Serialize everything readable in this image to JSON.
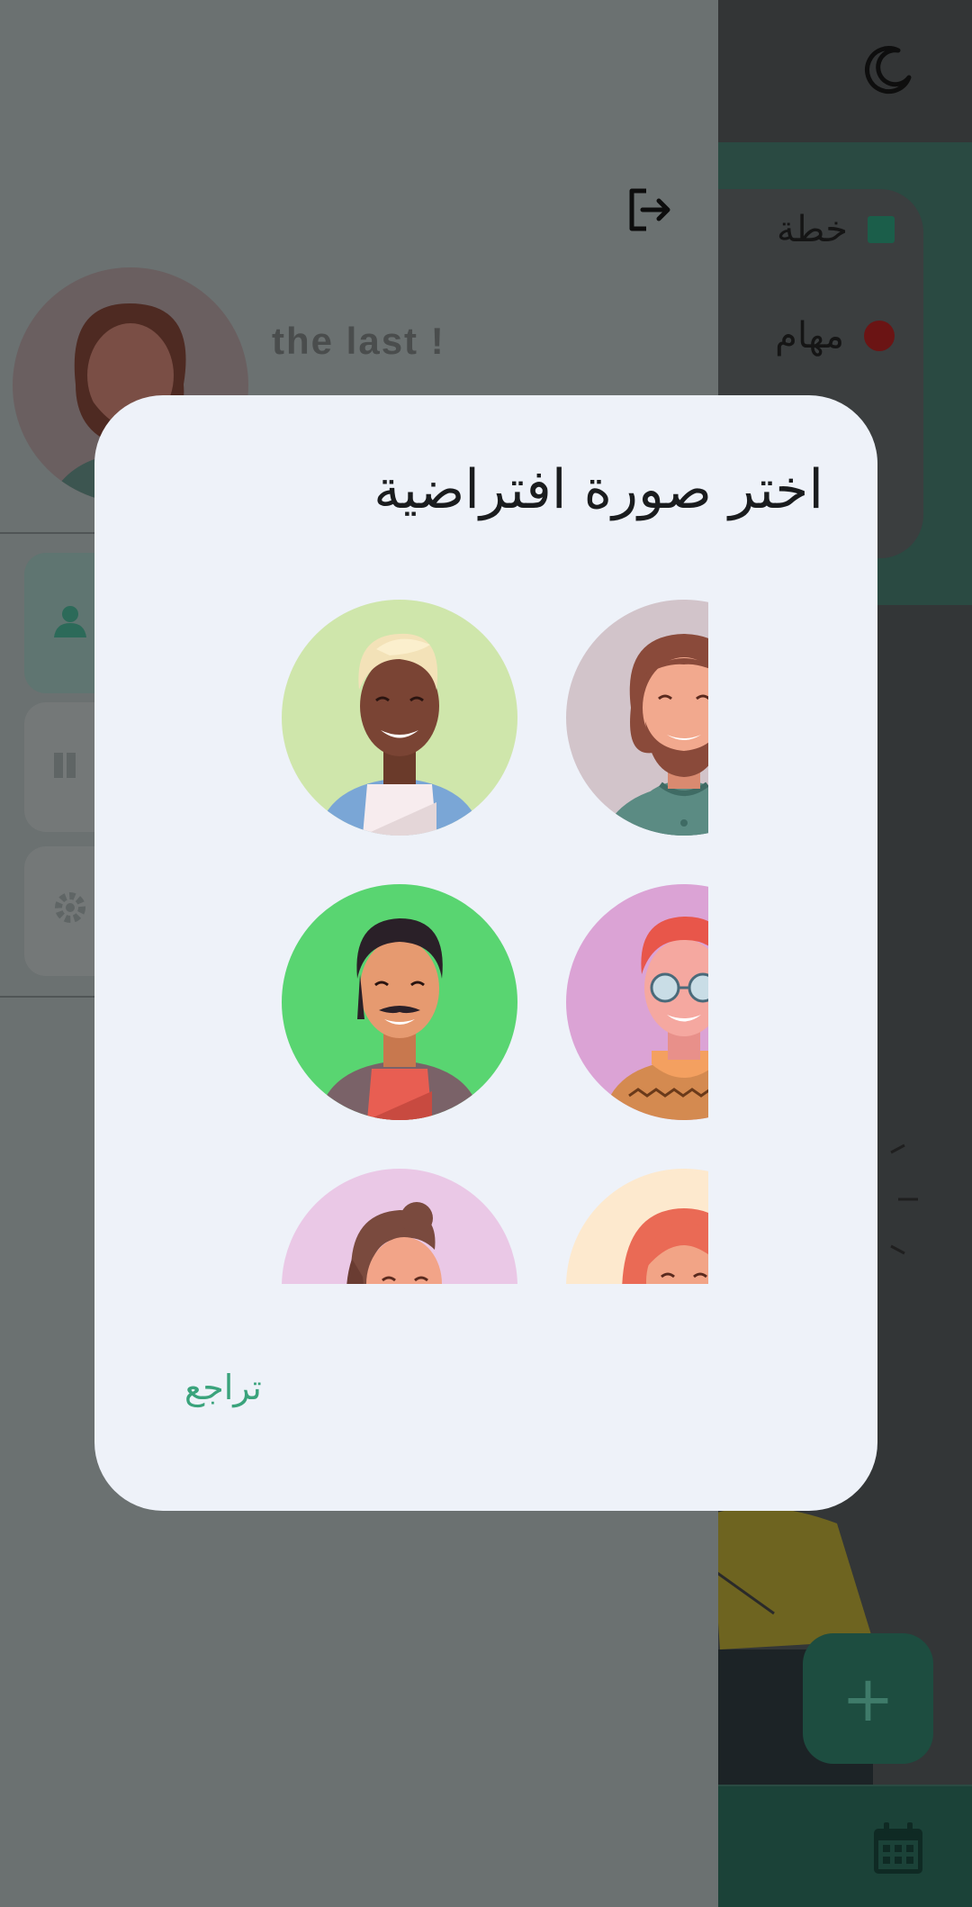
{
  "app": {
    "theme_toggle_icon": "moon-icon",
    "plan_items": [
      {
        "label": "خطة",
        "marker": "square",
        "color": "#1b5e4a"
      },
      {
        "label": "مهام",
        "marker": "dot",
        "color": "#6b1414"
      }
    ],
    "fab_label": "+",
    "bottom_nav_icon": "calendar-icon"
  },
  "drawer": {
    "user_name": "the last !",
    "logout_icon": "logout-icon",
    "menu_icons": [
      "person-icon",
      "book-icon",
      "gear-icon"
    ]
  },
  "dialog": {
    "title": "اختر صورة افتراضية",
    "avatars": [
      {
        "name": "bearded-man-avatar",
        "bg": "#d2c4ca"
      },
      {
        "name": "blond-man-avatar",
        "bg": "#cfe6ab"
      },
      {
        "name": "redhead-glasses-avatar",
        "bg": "#dba3d5"
      },
      {
        "name": "mustache-man-avatar",
        "bg": "#59d571"
      },
      {
        "name": "red-hair-woman-avatar",
        "bg": "#fde9ce"
      },
      {
        "name": "brunette-woman-avatar",
        "bg": "#eac8e6"
      }
    ],
    "cancel_label": "تراجع"
  }
}
